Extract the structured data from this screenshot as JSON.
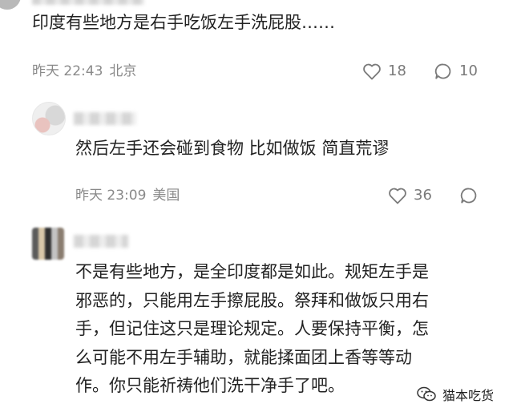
{
  "comments": [
    {
      "text": "印度有些地方是右手吃饭左手洗屁股……",
      "time": "昨天 22:43",
      "location": "北京",
      "likes": "18",
      "replies": "10"
    },
    {
      "text": "然后左手还会碰到食物 比如做饭 简直荒谬",
      "time": "昨天 23:09",
      "location": "美国",
      "likes": "36"
    },
    {
      "lines": [
        "不是有些地方，是全印度都是如此。规矩左手是",
        "邪恶的，只能用左手擦屁股。祭拜和做饭只用右",
        "手，但记住这只是理论规定。人要保持平衡，怎",
        "么可能不用左手辅助，就能揉面团上香等等动",
        "作。你只能祈祷他们洗干净手了吧。"
      ]
    }
  ],
  "watermark": {
    "icon": "wechat-icon",
    "label": "猫本吃货"
  },
  "icons": [
    "heart-icon",
    "comment-bubble-icon"
  ],
  "colors": {
    "text": "#222222",
    "meta": "#8a8a8a",
    "icon": "#7a7a7a"
  }
}
